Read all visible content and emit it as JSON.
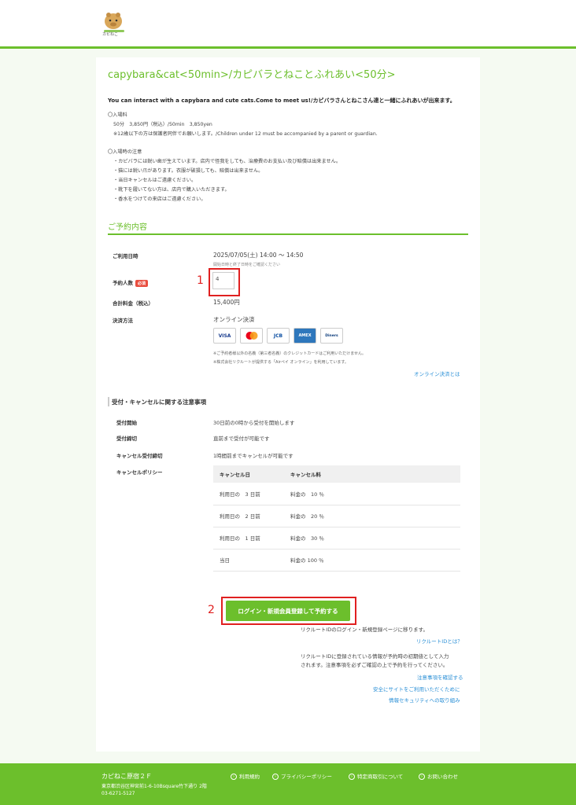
{
  "header": {
    "logo_text": "カピねこ"
  },
  "page": {
    "title": "capybara&cat<50min>/カピバラとねことふれあい<50分>",
    "lead": "You can interact with a capybara and cute cats.Come to meet us!/カピバラさんとねこさん達と一緒にふれあいが出来ます。",
    "fee": {
      "heading": "〇入場料",
      "line1": "50分　3,850円（税込）/50min　3,850yen",
      "line2": "※12歳以下の方は保護者同伴でお願いします。/Children under 12 must be accompanied by a parent or guardian."
    },
    "notes": {
      "heading": "〇入場時の注意",
      "items": [
        "・カピバラには鋭い歯が生えています。店内で怪我をしても、治療費のお支払い及び賠償は出来ません。",
        "・猫には鋭い爪があります。衣服が破損しても、賠償は出来ません。",
        "・当日キャンセルはご遠慮ください。",
        "・靴下を履いてない方は、店内で購入いただきます。",
        "・香水をつけての来店はご遠慮ください。"
      ]
    }
  },
  "reservation": {
    "heading": "ご予約内容",
    "date_label": "ご利用日時",
    "date_value": "2025/07/05(土) 14:00 〜 14:50",
    "date_note": "開始日時と終了日時をご確認ください",
    "people_label": "予約人数",
    "required_badge": "必須",
    "people_value": "4",
    "annotation_1": "1",
    "total_label": "合計料金（税込）",
    "total_value": "15,400円",
    "payment_label": "決済方法",
    "payment_value": "オンライン決済",
    "cards": [
      "VISA",
      "MC",
      "JCB",
      "AMEX",
      "Diners"
    ],
    "payment_note1": "※ご予約者様以外の名義（第三者名義）のクレジットカードはご利用いただけません。",
    "payment_note2": "※株式会社リクルートが提供する「Airペイ オンライン」を利用しています。",
    "online_link": "オンライン決済とは"
  },
  "cancel": {
    "heading": "受付・キャンセルに関する注意事項",
    "start_label": "受付開始",
    "start_value": "30日前の0時から受付を開始します",
    "end_label": "受付締切",
    "end_value": "直前まで受付が可能です",
    "cancel_label": "キャンセル受付締切",
    "cancel_value": "1時間前までキャンセルが可能です",
    "policy_label": "キャンセルポリシー",
    "col1": "キャンセル日",
    "col2": "キャンセル料",
    "rows": [
      {
        "day": "利用日の　3 日前",
        "fee": "料金の　10 ％"
      },
      {
        "day": "利用日の　2 日前",
        "fee": "料金の　20 ％"
      },
      {
        "day": "利用日の　1 日前",
        "fee": "料金の　30 ％"
      },
      {
        "day": "当日",
        "fee": "料金の 100 ％"
      }
    ]
  },
  "cta": {
    "annotation_2": "2",
    "button": "ログイン・新規会員登録して予約する",
    "note1": "リクルートIDのログイン・新規登録ページに移ります。",
    "recruit_link": "リクルートIDとは？",
    "note2a": "リクルートIDに登録されている情報が予約時の初期値として入力",
    "note2b": "されます。注意事項を必ずご確認の上で予約を行ってください。",
    "link_caution": "注意事項を確認する",
    "link_safe": "安全にサイトをご利用いただくために",
    "link_security": "情報セキュリティへの取り組み"
  },
  "footer": {
    "name": "カピねこ原宿２Ｆ",
    "address": "東京都渋谷区神宮前1-6-10Bsquare竹下通り 2階",
    "tel": "03-6271-5127",
    "nav": [
      "利用規約",
      "プライバシーポリシー",
      "特定商取引について",
      "お問い合わせ"
    ]
  },
  "colors": {
    "accent": "#6cbf2c",
    "highlight": "#e02020",
    "link": "#2a8fd6"
  }
}
